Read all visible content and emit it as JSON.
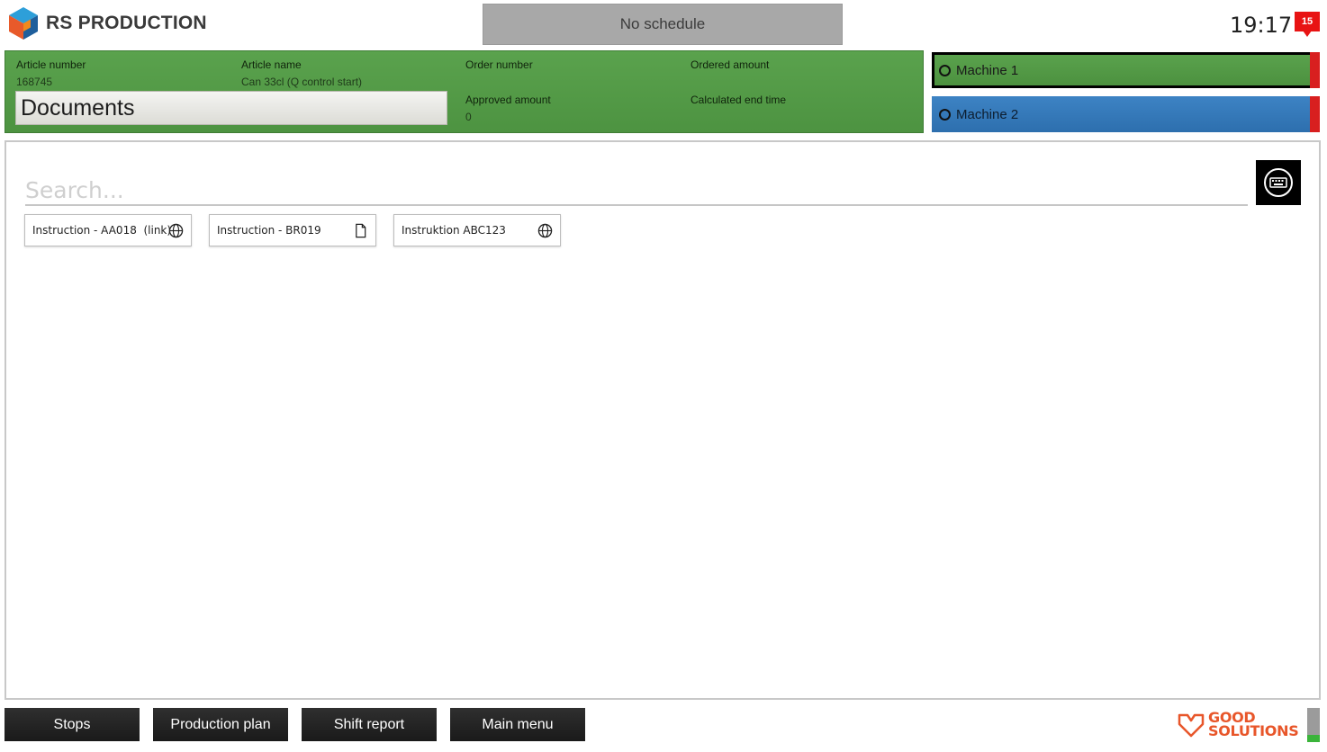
{
  "header": {
    "brand": "RS PRODUCTION",
    "schedule_label": "No schedule",
    "time": "19:17",
    "notification_count": "15"
  },
  "article": {
    "article_number_label": "Article number",
    "article_number": "168745",
    "article_name_label": "Article name",
    "article_name": "Can 33cl (Q control start)",
    "order_number_label": "Order number",
    "order_number": "",
    "ordered_amount_label": "Ordered amount",
    "ordered_amount": "",
    "approved_amount_label": "Approved amount",
    "approved_amount": "0",
    "calculated_end_time_label": "Calculated end time",
    "calculated_end_time": "",
    "documents_label": "Documents"
  },
  "machines": [
    {
      "name": "Machine 1",
      "color": "#5aa24d",
      "selected": true
    },
    {
      "name": "Machine 2",
      "color": "#3d83c4",
      "selected": false
    }
  ],
  "search": {
    "placeholder": "Search..."
  },
  "documents": [
    {
      "title": "Instruction - AA018  (link)",
      "icon": "globe-icon"
    },
    {
      "title": "Instruction - BR019",
      "icon": "file-icon"
    },
    {
      "title": "Instruktion ABC123",
      "icon": "globe-icon"
    }
  ],
  "nav": {
    "stops": "Stops",
    "production_plan": "Production plan",
    "shift_report": "Shift report",
    "main_menu": "Main menu"
  },
  "footer": {
    "brand_line1": "GOOD",
    "brand_line2": "SOLUTIONS"
  },
  "colors": {
    "accent_green": "#5aa24d",
    "accent_blue": "#3d83c4",
    "alert_red": "#e81313",
    "footer_orange": "#e8562a"
  }
}
